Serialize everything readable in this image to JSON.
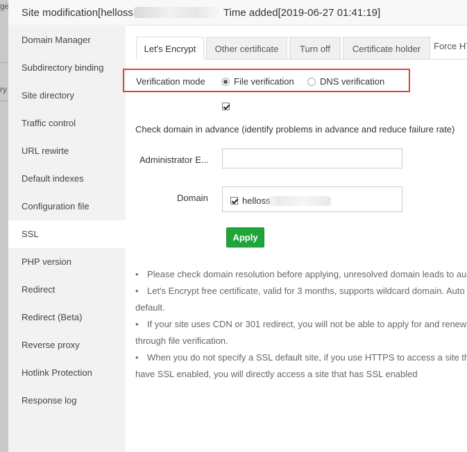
{
  "background": {
    "fragments": [
      "ge",
      "ry"
    ]
  },
  "dialog": {
    "title_prefix": "Site modification[helloss",
    "title_suffix": "Time added[2019-06-27 01:41:19]"
  },
  "sidebar": {
    "items": [
      {
        "label": "Domain Manager"
      },
      {
        "label": "Subdirectory binding"
      },
      {
        "label": "Site directory"
      },
      {
        "label": "Traffic control"
      },
      {
        "label": "URL rewirte"
      },
      {
        "label": "Default indexes"
      },
      {
        "label": "Configuration file"
      },
      {
        "label": "SSL"
      },
      {
        "label": "PHP version"
      },
      {
        "label": "Redirect"
      },
      {
        "label": "Redirect (Beta)"
      },
      {
        "label": "Reverse proxy"
      },
      {
        "label": "Hotlink Protection"
      },
      {
        "label": "Response log"
      }
    ],
    "active": "SSL"
  },
  "tabs": [
    {
      "label": "Let's Encrypt"
    },
    {
      "label": "Other certificate"
    },
    {
      "label": "Turn off"
    },
    {
      "label": "Certificate holder"
    },
    {
      "label": "Force HT"
    }
  ],
  "verification": {
    "label": "Verification mode",
    "options": [
      "File verification",
      "DNS verification"
    ],
    "selected": "File verification"
  },
  "precheck": {
    "checked": true,
    "text": "Check domain in advance (identify problems in advance and reduce failure rate)"
  },
  "form": {
    "email_label": "Administrator E...",
    "email_value": "",
    "domain_label": "Domain",
    "domain_item": "helloss",
    "domain_checked": true
  },
  "apply_label": "Apply",
  "notes": {
    "n1": "Please check domain resolution before applying, unresolved domain leads to au",
    "n2": "Let's Encrypt free certificate, valid for 3 months, supports wildcard domain. Auto",
    "n2b": "default.",
    "n3": "If your site uses CDN or 301 redirect, you will not be able to apply for and renew",
    "n3b": "through file verification.",
    "n4": "When you do not specify a SSL default site, if you use HTTPS to access a site that",
    "n4b": "have SSL enabled, you will directly access a site that has SSL enabled"
  },
  "colors": {
    "accent_green": "#20a53a",
    "highlight_red": "#e0403a",
    "sidebar_bg": "#f2f2f2"
  }
}
